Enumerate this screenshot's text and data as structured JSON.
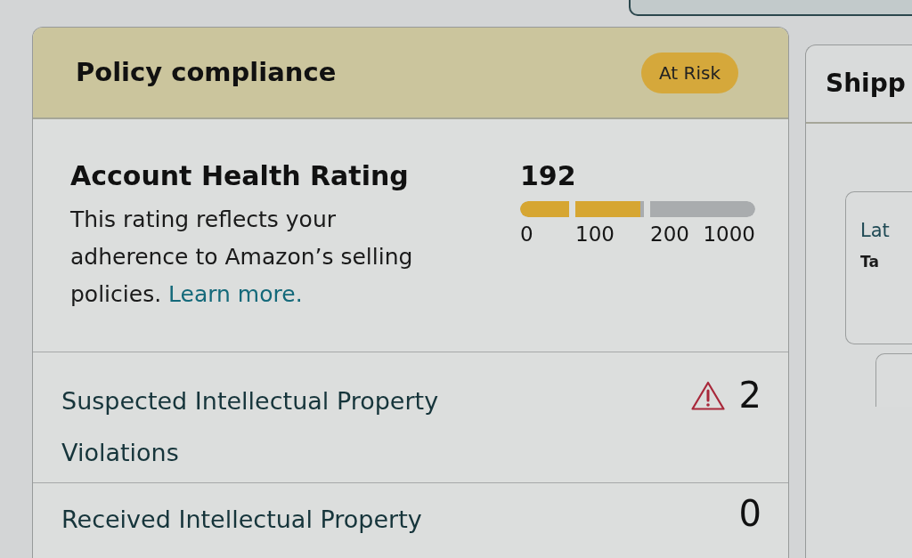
{
  "policy_card": {
    "title": "Policy compliance",
    "status_badge": "At Risk",
    "account_health": {
      "title": "Account Health Rating",
      "description": "This rating reflects your adherence to Amazon’s selling policies.",
      "link": "Learn more.",
      "score": "192",
      "rating_bar": {
        "level": 0.51
      },
      "scale_labels": [
        "0",
        "100",
        "200",
        "1000"
      ]
    },
    "issues": [
      {
        "label": "Suspected Intellectual Property Violations",
        "count": "2",
        "warning": true
      },
      {
        "label": "Received Intellectual Property",
        "count": "0",
        "warning": false
      }
    ]
  },
  "shipping_card": {
    "title": "Shipp",
    "inner_card": {
      "link": "Lat",
      "label": "Ta"
    }
  }
}
